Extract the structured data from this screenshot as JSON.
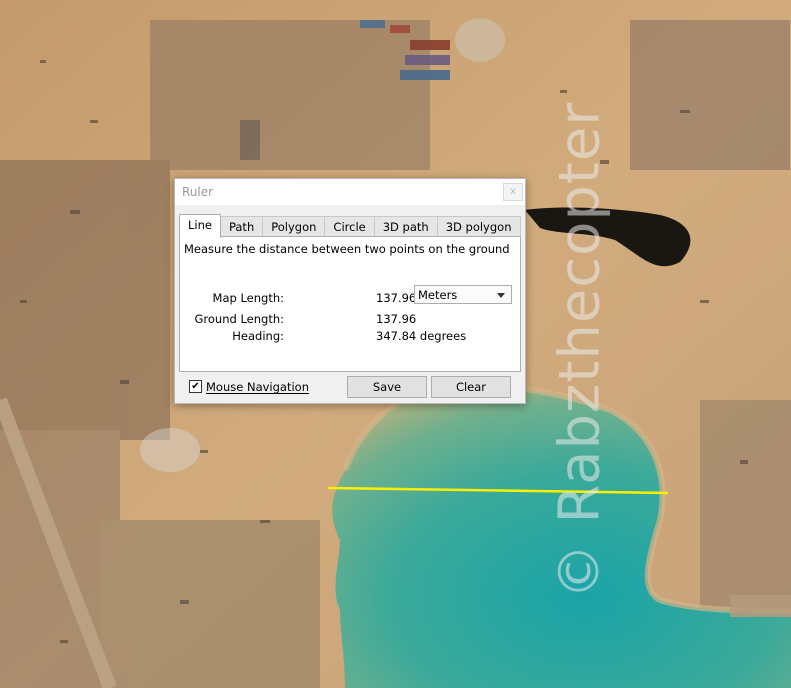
{
  "dialog": {
    "title": "Ruler",
    "close_glyph": "x",
    "tabs": [
      {
        "label": "Line",
        "active": true
      },
      {
        "label": "Path"
      },
      {
        "label": "Polygon"
      },
      {
        "label": "Circle"
      },
      {
        "label": "3D path"
      },
      {
        "label": "3D polygon"
      }
    ],
    "description": "Measure the distance between two points on the ground",
    "map_length": {
      "label": "Map Length:",
      "value": "137.96"
    },
    "units": {
      "selected": "Meters"
    },
    "ground_length": {
      "label": "Ground Length:",
      "value": "137.96"
    },
    "heading": {
      "label": "Heading:",
      "value": "347.84 degrees"
    },
    "mouse_navigation": {
      "label": "Mouse Navigation",
      "checked": true,
      "check_glyph": "✔"
    },
    "save_label": "Save",
    "clear_label": "Clear"
  },
  "map": {
    "watermark": "© Rabzthecopter",
    "measure_line_color": "#ffee00",
    "water_color": "#1f9fa0",
    "ground_color": "#c8a070"
  }
}
